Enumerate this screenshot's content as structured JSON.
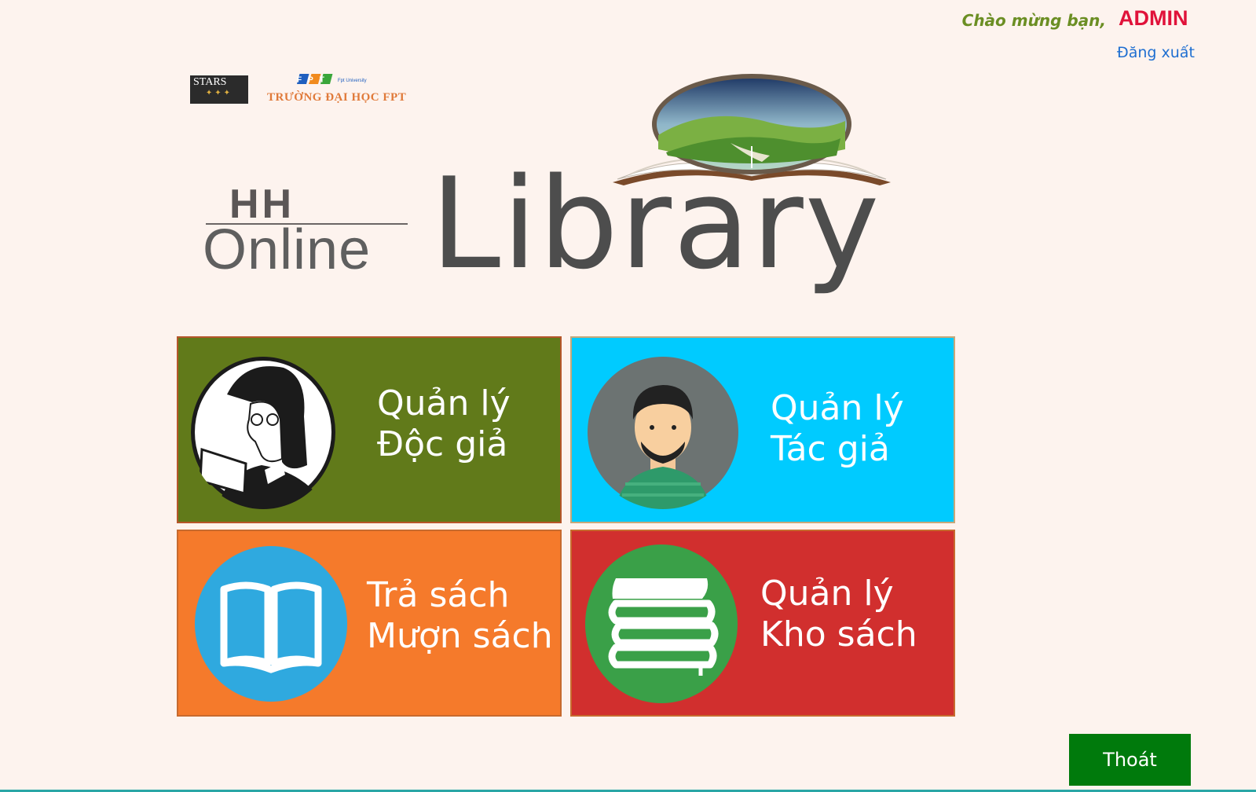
{
  "header": {
    "welcome_label": "Chào mừng bạn,",
    "username": "ADMIN",
    "logout_label": "Đăng xuất"
  },
  "partners": {
    "stars_text": "STARS",
    "fpt_text": "FPT",
    "fpt_small": "Fpt University",
    "fpt_caption": "TRƯỜNG ĐẠI HỌC FPT"
  },
  "brand": {
    "mark": "HH",
    "online": "Online",
    "library": "Library"
  },
  "tiles": [
    {
      "line1": "Quản lý",
      "line2": "Độc giả",
      "color": "#617a1a"
    },
    {
      "line1": "Quản lý",
      "line2": "Tác giả",
      "color": "#00cbff"
    },
    {
      "line1": "Trả sách",
      "line2": "Mượn sách",
      "color": "#f57a2b"
    },
    {
      "line1": "Quản lý",
      "line2": "Kho sách",
      "color": "#d12f2e"
    }
  ],
  "exit_label": "Thoát",
  "colors": {
    "background": "#fdf3ee",
    "username": "#e0123a",
    "link": "#1f6fd1",
    "exit_button": "#007a0c"
  }
}
